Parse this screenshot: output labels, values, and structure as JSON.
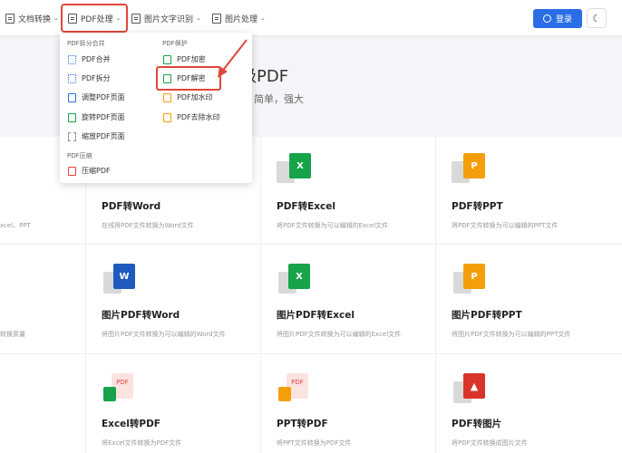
{
  "nav": {
    "items": [
      {
        "label": "文档转换"
      },
      {
        "label": "PDF处理"
      },
      {
        "label": "图片文字识别"
      },
      {
        "label": "图片处理"
      }
    ],
    "login_label": "登录",
    "theme_icon": "moon-icon"
  },
  "hero": {
    "title": "级PDF",
    "subtitle": "简单，强大"
  },
  "dropdown": {
    "group_split": "PDF拆分合并",
    "group_protect": "PDF保护",
    "group_compress": "PDF压缩",
    "items_left": [
      "PDF合并",
      "PDF拆分",
      "调整PDF页面",
      "旋转PDF页面",
      "缩放PDF页面"
    ],
    "items_right": [
      "PDF加密",
      "PDF解密",
      "PDF加水印",
      "PDF去除水印"
    ],
    "compress_item": "压缩PDF"
  },
  "cards": {
    "row1": [
      {
        "title": "",
        "desc": "xcel、PPT"
      },
      {
        "title": "PDF转Word",
        "desc": "在线将PDF文件转换为Word文件"
      },
      {
        "title": "PDF转Excel",
        "desc": "将PDF文件转换为可以编辑的Excel文件",
        "icon": "X"
      },
      {
        "title": "PDF转PPT",
        "desc": "将PDF文件转换为可以编辑的PPT文件",
        "icon": "P"
      }
    ],
    "row2": [
      {
        "title": "",
        "desc": "转换质量"
      },
      {
        "title": "图片PDF转Word",
        "desc": "将图片PDF文件转换为可以编辑的Word文件",
        "icon": "W"
      },
      {
        "title": "图片PDF转Excel",
        "desc": "将图片PDF文件转换为可以编辑的Excel文件",
        "icon": "X"
      },
      {
        "title": "图片PDF转PPT",
        "desc": "将图片PDF文件转换为可以编辑的PPT文件",
        "icon": "P"
      }
    ],
    "row3": [
      {
        "title": "",
        "desc": ""
      },
      {
        "title": "Excel转PDF",
        "desc": "将Excel文件转换为PDF文件",
        "icon": "PDF"
      },
      {
        "title": "PPT转PDF",
        "desc": "将PPT文件转换为PDF文件",
        "icon": "PDF"
      },
      {
        "title": "PDF转图片",
        "desc": "将PDF文件转换成图片文件"
      }
    ]
  },
  "colors": {
    "accent": "#2b6de5",
    "highlight": "#e0463a",
    "excel": "#16a34a",
    "word": "#1f5bbf",
    "ppt": "#f59e0b"
  }
}
